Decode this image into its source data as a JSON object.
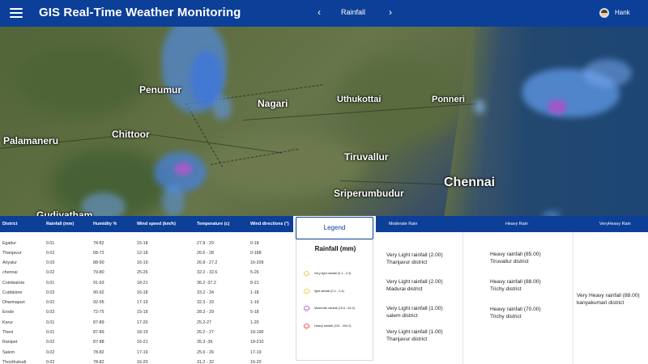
{
  "header": {
    "title": "GIS Real-Time Weather Monitoring",
    "layer": "Rainfall",
    "prev_glyph": "‹",
    "next_glyph": "›",
    "user": "Hank",
    "bg_color": "#0c3f98"
  },
  "map": {
    "cities": [
      "Penumur",
      "Nagari",
      "Uthukottai",
      "Ponneri",
      "Chittoor",
      "Palamaneru",
      "Tiruvallur",
      "Chennai",
      "Sriperumbudur",
      "Gudiyatham"
    ]
  },
  "table": {
    "headers": [
      "District",
      "Rainfall (mm)",
      "Humidity %",
      "Wind speed (km/h)",
      "Temperature (c)",
      "Wind directions (°)"
    ],
    "rows": [
      [
        "Egattur",
        "0.01",
        "78-82",
        "15-18",
        "27.8 - 29",
        "0-18"
      ],
      [
        "Thanjavur",
        "0.02",
        "68-72",
        "12-18",
        "26.6 - 28",
        "0-188"
      ],
      [
        "Ariyalur",
        "0.03",
        "88-90",
        "16-19",
        "26.8 - 27.2",
        "16-209"
      ],
      [
        "chennai",
        "0.02",
        "79-80",
        "25-26",
        "32.2 - 32.6",
        "5-26"
      ],
      [
        "Coimbatore",
        "0.01",
        "91-93",
        "18-21",
        "36.2 -37.2",
        "8-21"
      ],
      [
        "Cuddalore",
        "0.03",
        "90-92",
        "16-18",
        "33.2 - 34",
        "1-18"
      ],
      [
        "Dharmapuri",
        "0.02",
        "92-95",
        "17-19",
        "32.3 - 33",
        "1-19"
      ],
      [
        "Erode",
        "0.03",
        "72-75",
        "15-18",
        "28.3 - 29",
        "5-18"
      ],
      [
        "Karur",
        "0.01",
        "87-89",
        "17-20",
        "25.2-27",
        "1-20"
      ],
      [
        "Theni",
        "0.01",
        "87-89",
        "18-19",
        "26.2 - 27",
        "18-190"
      ],
      [
        "Ranipet",
        "0.02",
        "87-88",
        "16-21",
        "35.3 -36",
        "18-210"
      ],
      [
        "Salem",
        "0.02",
        "78-82",
        "17-19",
        "25.6 - 26",
        "17-19"
      ],
      [
        "Thoothukudi",
        "0.02",
        "78-82",
        "16-20",
        "31.2 - 32",
        "16-20"
      ]
    ]
  },
  "legend": {
    "header": "Legend",
    "title": "Rainfall (mm)",
    "items": [
      {
        "label": "Very light rainfall (0.1 - 2.4)",
        "color": "#e6c64a"
      },
      {
        "label": "light rainfall (0.1 - 2.4)",
        "color": "#f0c93a"
      },
      {
        "label": "Moderate rainfall (15.6 - 62.4)",
        "color": "#b24bc9"
      },
      {
        "label": "Heavy rainfall (115 - 204.4)",
        "color": "#e0433b"
      }
    ]
  },
  "rain": {
    "columns": [
      "Moderate Rain",
      "Heavy Rain",
      "VeryHeavy  Rain"
    ],
    "moderate": [
      {
        "amount": "Very Light rainfall (2.00)",
        "district": "Thanjavur district"
      },
      {
        "amount": "Very Light rainfall (2.00)",
        "district": "Madurai district"
      },
      {
        "amount": "Very Light rainfall (1.00)",
        "district": "salem district"
      },
      {
        "amount": "Very Light rainfall (1.00)",
        "district": "Thanjavur district"
      }
    ],
    "heavy": [
      {
        "amount": "Heavy rainfall (85.00)",
        "district": "Tiruvallur district"
      },
      {
        "amount": "Heavy rainfall (88.00)",
        "district": "Trichy district"
      },
      {
        "amount": "Heavy rainfall (70.00)",
        "district": "Trichy district"
      }
    ],
    "very_heavy": [
      {
        "amount": "Very Heavy rainfall (88.00)",
        "district": "kanyakumari district"
      }
    ]
  }
}
